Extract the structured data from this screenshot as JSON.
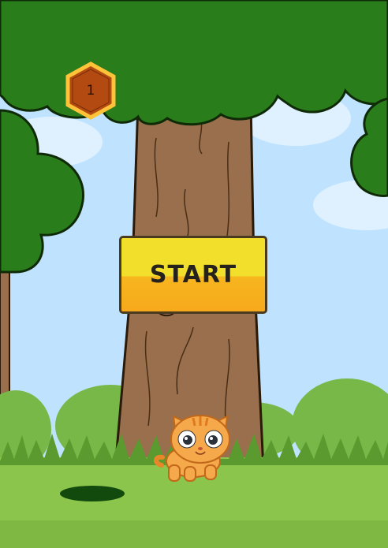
{
  "game": {
    "level": "1",
    "start_label": "START",
    "character": "cat-character",
    "scene": "forest-tree"
  },
  "colors": {
    "sky": "#bfe3ff",
    "cloud": "#dff1ff",
    "foliage": "#2a7d1b",
    "foliage_outline": "#0f2a07",
    "trunk": "#996f4d",
    "grass": "#8cc54b",
    "button_top": "#f1df2c",
    "button_bottom": "#f6a91c",
    "badge_fill": "#b24a12",
    "badge_border": "#ffc33a"
  }
}
